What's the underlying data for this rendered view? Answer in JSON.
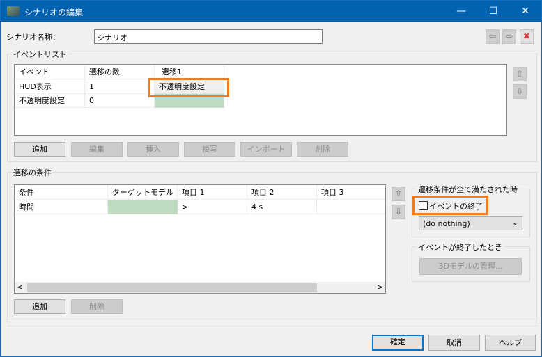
{
  "window": {
    "title": "シナリオの編集",
    "minimize": "—",
    "maximize": "☐",
    "close": "✕"
  },
  "scenario": {
    "label": "シナリオ名称：",
    "value": "シナリオ"
  },
  "nav": {
    "prev": "⇦",
    "next": "⇨",
    "delete": "✖"
  },
  "event_list": {
    "title": "イベントリスト",
    "columns": [
      "イベント",
      "遷移の数",
      "遷移1"
    ],
    "rows": [
      [
        "HUD表示",
        "1",
        "不透明度設定"
      ],
      [
        "不透明度設定",
        "0",
        ""
      ]
    ],
    "buttons": [
      "追加",
      "編集",
      "挿入",
      "複写",
      "インポート",
      "削除"
    ],
    "up": "⇧",
    "down": "⇩"
  },
  "conditions": {
    "title": "遷移の条件",
    "columns": [
      "条件",
      "ターゲットモデル",
      "項目 1",
      "項目 2",
      "項目 3"
    ],
    "rows": [
      [
        "時間",
        "",
        ">",
        "4 s",
        ""
      ]
    ],
    "buttons": [
      "追加",
      "削除"
    ],
    "up": "⇧",
    "down": "⇩",
    "scroll_left": "<",
    "scroll_right": ">"
  },
  "when_all_met": {
    "title": "遷移条件が全て満たされた時",
    "checkbox_label": "イベントの終了",
    "checked": false,
    "dropdown_value": "(do nothing)",
    "dropdown_arrow": "⌄"
  },
  "when_event_ends": {
    "title": "イベントが終了したとき",
    "button": "3Dモデルの管理..."
  },
  "footer": {
    "ok": "確定",
    "cancel": "取消",
    "help": "ヘルプ"
  },
  "colors": {
    "titlebar": "#0063b1",
    "highlight": "#f47c20",
    "green_cell": "#c0dcc0"
  }
}
